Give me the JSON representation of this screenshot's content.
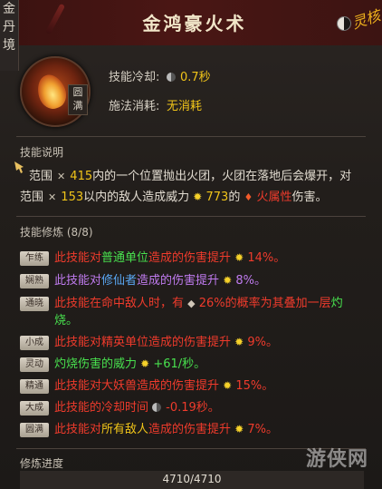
{
  "realm": [
    "金",
    "丹",
    "境"
  ],
  "skill": {
    "title": "金鸿豪火术",
    "tier_badge": "圆满",
    "corner_text": "灵核",
    "cooldown_label": "技能冷却:",
    "cooldown_value": "0.7秒",
    "cost_label": "施法消耗:",
    "cost_value": "无消耗",
    "icon": "fire-ghost-icon"
  },
  "description": {
    "heading": "技能说明",
    "p1_pre": "范围",
    "p1_val": "415",
    "p1_mid": "内的一个位置抛出火团，火团在落地后会爆开，对",
    "p2_pre": "范围",
    "p2_val": "153",
    "p2_mid": "以内的敌人造成威力",
    "p2_power": "773",
    "p2_of": "的",
    "p2_element": "火属性",
    "p2_end": "伤害。"
  },
  "cultivation": {
    "heading": "技能修炼",
    "count": "(8/8)",
    "rows": [
      {
        "tag": "乍练",
        "a": "此技能对",
        "b": "普通单位",
        "c": "造成的伤害提升",
        "d": "14%。"
      },
      {
        "tag": "娴熟",
        "a": "此技能对",
        "b": "修仙者",
        "c": "造成的伤害提升",
        "d": "8%。"
      },
      {
        "tag": "通晓",
        "a": "此技能在命中敌人时，有",
        "b": "26%的概率为其叠加一层",
        "c": "灼",
        "d": "烧。"
      },
      {
        "tag": "小成",
        "a": "此技能对精英单位造成的伤害提升",
        "b": "9%。"
      },
      {
        "tag": "灵动",
        "a": "灼烧伤害的威力",
        "b": "+61/秒。"
      },
      {
        "tag": "精通",
        "a": "此技能对大妖兽造成的伤害提升",
        "b": "15%。"
      },
      {
        "tag": "大成",
        "a": "此技能的冷却时间",
        "b": "-0.19秒。"
      },
      {
        "tag": "圆满",
        "a": "此技能对",
        "b": "所有敌人",
        "c": "造成的伤害提升",
        "d": "7%。"
      }
    ]
  },
  "progress": {
    "heading": "修炼进度",
    "text": "4710/4710",
    "fraction": 1.0
  },
  "watermark": "游侠网",
  "colors": {
    "gold": "#f0c419",
    "fire": "#ef3b2c",
    "green": "#48e04e",
    "blue": "#5aa8f5",
    "purple": "#c07bf0"
  }
}
